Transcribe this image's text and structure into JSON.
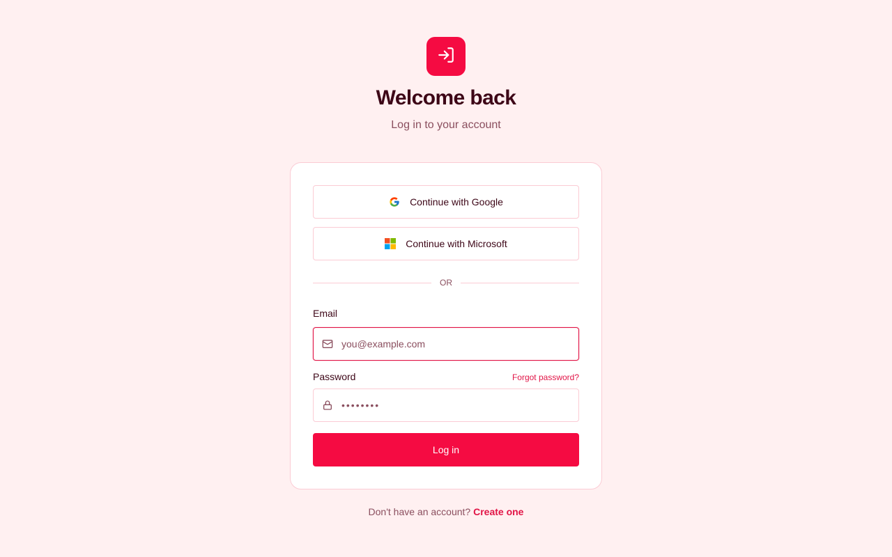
{
  "header": {
    "logo_icon": "log-in-icon",
    "title": "Welcome back",
    "subtitle": "Log in to your account"
  },
  "oauth": {
    "google_label": "Continue with Google",
    "google_icon": "google-icon",
    "microsoft_label": "Continue with Microsoft",
    "microsoft_icon": "microsoft-icon"
  },
  "divider": {
    "label": "OR"
  },
  "form": {
    "email_label": "Email",
    "email_placeholder": "you@example.com",
    "email_value": "",
    "password_label": "Password",
    "password_value": "••••••••",
    "forgot_label": "Forgot password?",
    "submit_label": "Log in"
  },
  "footer": {
    "prompt": "Don't have an account?",
    "link": "Create one"
  },
  "colors": {
    "accent": "#f50b42",
    "background": "#fff0f1",
    "text": "#3d0617",
    "muted": "#8a4e5e",
    "border": "#fbcbd4"
  }
}
